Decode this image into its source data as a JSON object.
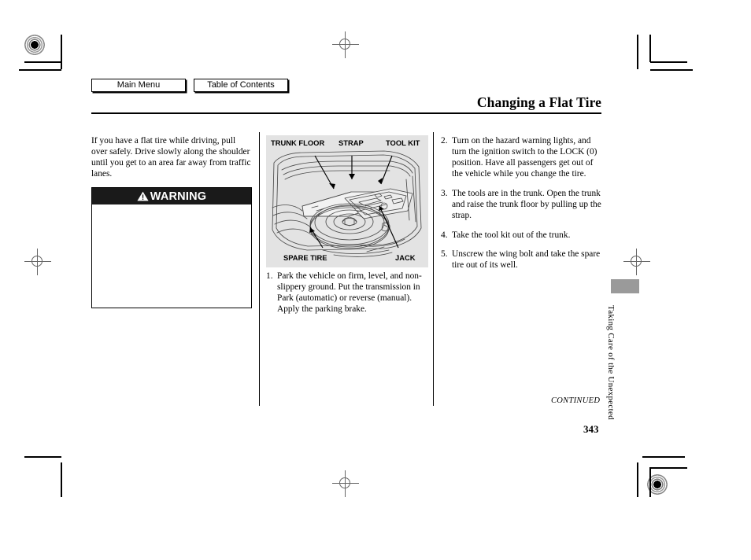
{
  "nav": {
    "main_menu": "Main Menu",
    "table_of_contents": "Table of Contents"
  },
  "header": {
    "title": "Changing a Flat Tire"
  },
  "intro": {
    "text": "If you have a flat tire while driving, pull over safely. Drive slowly along the shoulder until you get to an area far away from traffic lanes."
  },
  "warning": {
    "label": "WARNING",
    "body": ""
  },
  "figure": {
    "labels": {
      "trunk_floor": "TRUNK FLOOR",
      "strap": "STRAP",
      "tool_kit": "TOOL KIT",
      "spare_tire": "SPARE TIRE",
      "jack": "JACK"
    },
    "background_color": "#e3e3e3"
  },
  "steps_middle": [
    {
      "num": "1.",
      "text": "Park the vehicle on firm, level, and non-slippery ground. Put the transmission in Park (automatic) or reverse (manual). Apply the parking brake."
    }
  ],
  "steps_right": [
    {
      "num": "2.",
      "text": "Turn on the hazard warning lights, and turn the ignition switch to the LOCK (0) position. Have all passengers get out of the vehicle while you change the tire."
    },
    {
      "num": "3.",
      "text": "The tools are in the trunk. Open the trunk and raise the trunk floor by pulling up the strap."
    },
    {
      "num": "4.",
      "text": "Take the tool kit out of the trunk."
    },
    {
      "num": "5.",
      "text": "Unscrew the wing bolt and take the spare tire out of its well."
    }
  ],
  "footer": {
    "continued": "CONTINUED",
    "page_number": "343"
  },
  "side_tab": {
    "section_title": "Taking Care of the Unexpected",
    "tab_color": "#9a9a9a"
  }
}
